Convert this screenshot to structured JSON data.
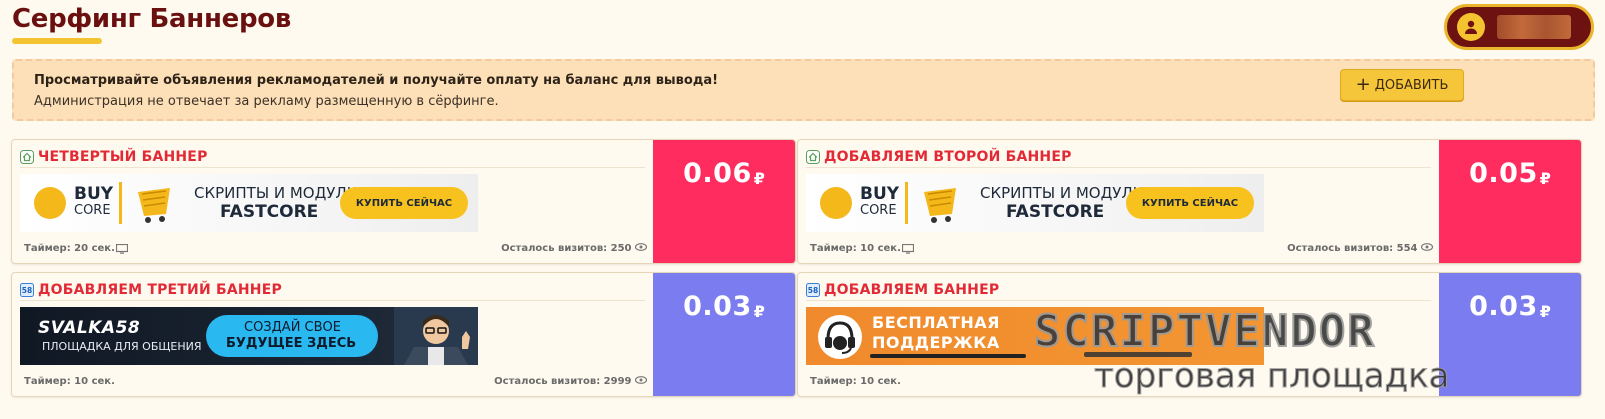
{
  "header": {
    "title": "Серфинг Баннеров"
  },
  "user": {
    "avatar_icon": "user-icon"
  },
  "info": {
    "bold_text": "Просматривайте объявления рекламодателей и получайте оплату на баланс для вывода!",
    "text": "Администрация не отвечает за рекламу размещенную в сёрфинге.",
    "add_button": {
      "icon": "+",
      "label": "ДОБАВИТЬ"
    }
  },
  "cards": [
    {
      "title": "ЧЕТВЕРТЫЙ БАННЕР",
      "site_icon": "home-icon",
      "timer": "Таймер: 20 сек.",
      "visits": "Осталось визитов: 250",
      "price": "0.06",
      "currency": "₽",
      "price_color": "#ff2d5f",
      "banner": {
        "buy": "BUY",
        "core": "CORE",
        "scripts": "СКРИПТЫ И МОДУЛИ",
        "fastcore": "FASTCORE",
        "cta": "КУПИТЬ СЕЙЧАС"
      }
    },
    {
      "title": "ДОБАВЛЯЕМ ВТОРОЙ БАННЕР",
      "site_icon": "home-icon",
      "timer": "Таймер: 10 сек.",
      "visits": "Осталось визитов: 554",
      "price": "0.05",
      "currency": "₽",
      "price_color": "#ff2d5f",
      "banner": {
        "buy": "BUY",
        "core": "CORE",
        "scripts": "СКРИПТЫ И МОДУЛИ",
        "fastcore": "FASTCORE",
        "cta": "КУПИТЬ СЕЙЧАС"
      }
    },
    {
      "title": "ДОБАВЛЯЕМ ТРЕТИЙ БАННЕР",
      "site_icon": "58",
      "timer": "Таймер: 10 сек.",
      "visits": "Осталось визитов: 2999",
      "price": "0.03",
      "currency": "₽",
      "price_color": "#7b7cf0",
      "banner": {
        "logo": "SVALKA58",
        "tagline": "ПЛОЩАДКА ДЛЯ ОБЩЕНИЯ",
        "cta_line1": "СОЗДАЙ СВОЕ",
        "cta_line2": "БУДУЩЕЕ ЗДЕСЬ"
      }
    },
    {
      "title": "ДОБАВЛЯЕМ БАННЕР",
      "site_icon": "58",
      "timer": "Таймер: 10 сек.",
      "price": "0.03",
      "currency": "₽",
      "price_color": "#7b7cf0",
      "banner": {
        "line1": "БЕСПЛАТНАЯ",
        "line2": "ПОДДЕРЖКА"
      }
    }
  ],
  "watermark": {
    "logo": "SCRIPTVENDOR",
    "subtitle": "торговая площадка"
  }
}
